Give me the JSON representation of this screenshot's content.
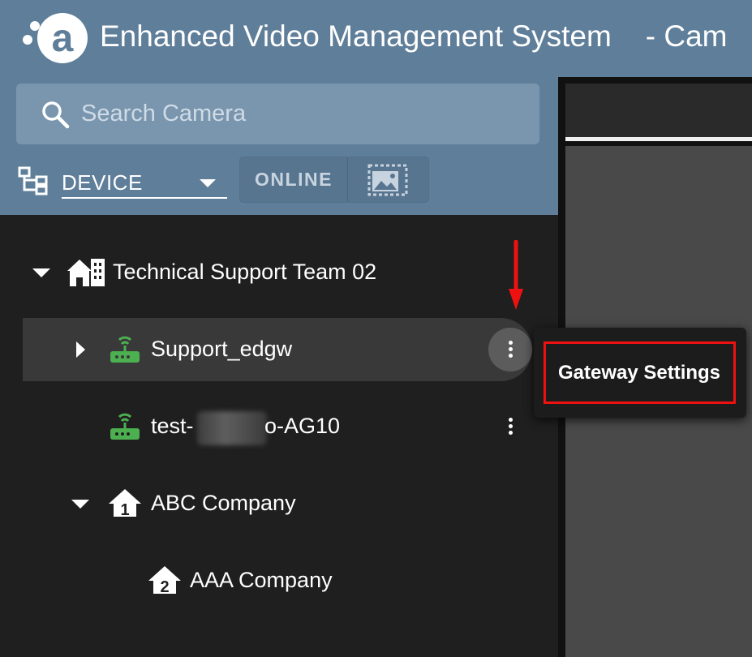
{
  "app": {
    "title": "Enhanced Video Management System",
    "title_suffix": "- Cam"
  },
  "search": {
    "placeholder": "Search Camera"
  },
  "filter": {
    "selected": "DEVICE",
    "online_label": "ONLINE"
  },
  "tree": {
    "items": [
      {
        "label": "Technical Support Team 02",
        "icon": "building-icon",
        "expanded": true
      },
      {
        "label": "Support_edgw",
        "icon": "gateway-icon",
        "status_color": "#4caf50",
        "selected": true
      },
      {
        "label_prefix": "test-",
        "label_suffix": "o-AG10",
        "icon": "gateway-icon",
        "status_color": "#4caf50"
      },
      {
        "label": "ABC Company",
        "icon": "home-1-icon",
        "expanded": true
      },
      {
        "label": "AAA Company",
        "icon": "home-2-icon"
      }
    ]
  },
  "context_menu": {
    "items": [
      "Gateway Settings"
    ]
  },
  "colors": {
    "header": "#5f7e99",
    "highlight": "#ee1111",
    "online_green": "#4caf50"
  }
}
